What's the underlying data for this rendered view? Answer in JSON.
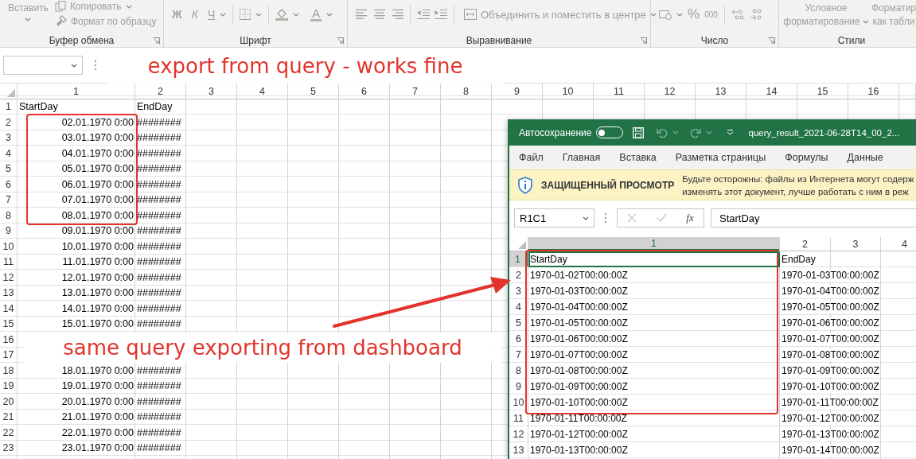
{
  "ribbon": {
    "clipboard": {
      "paste": "Вставить",
      "copy": "Копировать",
      "format_painter": "Формат по образцу",
      "label": "Буфер обмена"
    },
    "font": {
      "bold": "Ж",
      "italic": "К",
      "underline": "Ч",
      "font_color": "A",
      "label": "Шрифт"
    },
    "alignment": {
      "merge": "Объединить и поместить в центре",
      "label": "Выравнивание"
    },
    "number": {
      "percent": "%",
      "thousands": "000",
      "label": "Число"
    },
    "styles": {
      "conditional": "Условное форматирование",
      "format_table": "Форматир как табли",
      "label": "Стили"
    }
  },
  "sheet": {
    "columns": [
      "1",
      "2",
      "3",
      "4",
      "5",
      "6",
      "7",
      "8",
      "9",
      "10",
      "11",
      "12",
      "13",
      "14",
      "15",
      "16"
    ],
    "rows": [
      {
        "label": "1",
        "cells": [
          "StartDay",
          "EndDay"
        ]
      },
      {
        "label": "2",
        "cells": [
          "02.01.1970 0:00",
          "########"
        ]
      },
      {
        "label": "3",
        "cells": [
          "03.01.1970 0:00",
          "########"
        ]
      },
      {
        "label": "4",
        "cells": [
          "04.01.1970 0:00",
          "########"
        ]
      },
      {
        "label": "5",
        "cells": [
          "05.01.1970 0:00",
          "########"
        ]
      },
      {
        "label": "6",
        "cells": [
          "06.01.1970 0:00",
          "########"
        ]
      },
      {
        "label": "7",
        "cells": [
          "07.01.1970 0:00",
          "########"
        ]
      },
      {
        "label": "8",
        "cells": [
          "08.01.1970 0:00",
          "########"
        ]
      },
      {
        "label": "9",
        "cells": [
          "09.01.1970 0:00",
          "########"
        ]
      },
      {
        "label": "10",
        "cells": [
          "10.01.1970 0:00",
          "########"
        ]
      },
      {
        "label": "11",
        "cells": [
          "11.01.1970 0:00",
          "########"
        ]
      },
      {
        "label": "12",
        "cells": [
          "12.01.1970 0:00",
          "########"
        ]
      },
      {
        "label": "13",
        "cells": [
          "13.01.1970 0:00",
          "########"
        ]
      },
      {
        "label": "14",
        "cells": [
          "14.01.1970 0:00",
          "########"
        ]
      },
      {
        "label": "15",
        "cells": [
          "15.01.1970 0:00",
          "########"
        ]
      },
      {
        "label": "16"
      },
      {
        "label": "17"
      },
      {
        "label": "18",
        "cells": [
          "18.01.1970 0:00",
          "########"
        ]
      },
      {
        "label": "19",
        "cells": [
          "19.01.1970 0:00",
          "########"
        ]
      },
      {
        "label": "20",
        "cells": [
          "20.01.1970 0:00",
          "########"
        ]
      },
      {
        "label": "21",
        "cells": [
          "21.01.1970 0:00",
          "########"
        ]
      },
      {
        "label": "22",
        "cells": [
          "22.01.1970 0:00",
          "########"
        ]
      },
      {
        "label": "23",
        "cells": [
          "23.01.1970 0:00",
          "########"
        ]
      }
    ]
  },
  "window": {
    "autosave_label": "Автосохранение",
    "autosave_on": false,
    "title": "query_result_2021-06-28T14_00_2...",
    "menu": [
      "Файл",
      "Главная",
      "Вставка",
      "Разметка страницы",
      "Формулы",
      "Данные"
    ],
    "protected_view": {
      "title": "ЗАЩИЩЕННЫЙ ПРОСМОТР",
      "message_lines": [
        "Будьте осторожны: файлы из Интернета могут содерж",
        "изменять этот документ, лучше работать с ним в реж"
      ]
    },
    "name_box": "R1C1",
    "function_button": "fx",
    "formula": "StartDay",
    "sheet": {
      "columns": [
        {
          "label": "1",
          "selected": true
        },
        {
          "label": "2",
          "selected": false
        },
        {
          "label": "3",
          "selected": false
        },
        {
          "label": "4",
          "selected": false
        }
      ],
      "rows": [
        {
          "label": "1",
          "selected": true,
          "cells": [
            "StartDay",
            "EndDay"
          ]
        },
        {
          "label": "2",
          "selected": false,
          "cells": [
            "1970-01-02T00:00:00Z",
            "1970-01-03T00:00:00Z"
          ]
        },
        {
          "label": "3",
          "selected": false,
          "cells": [
            "1970-01-03T00:00:00Z",
            "1970-01-04T00:00:00Z"
          ]
        },
        {
          "label": "4",
          "selected": false,
          "cells": [
            "1970-01-04T00:00:00Z",
            "1970-01-05T00:00:00Z"
          ]
        },
        {
          "label": "5",
          "selected": false,
          "cells": [
            "1970-01-05T00:00:00Z",
            "1970-01-06T00:00:00Z"
          ]
        },
        {
          "label": "6",
          "selected": false,
          "cells": [
            "1970-01-06T00:00:00Z",
            "1970-01-07T00:00:00Z"
          ]
        },
        {
          "label": "7",
          "selected": false,
          "cells": [
            "1970-01-07T00:00:00Z",
            "1970-01-08T00:00:00Z"
          ]
        },
        {
          "label": "8",
          "selected": false,
          "cells": [
            "1970-01-08T00:00:00Z",
            "1970-01-09T00:00:00Z"
          ]
        },
        {
          "label": "9",
          "selected": false,
          "cells": [
            "1970-01-09T00:00:00Z",
            "1970-01-10T00:00:00Z"
          ]
        },
        {
          "label": "10",
          "selected": false,
          "cells": [
            "1970-01-10T00:00:00Z",
            "1970-01-11T00:00:00Z"
          ]
        },
        {
          "label": "11",
          "selected": false,
          "cells": [
            "1970-01-11T00:00:00Z",
            "1970-01-12T00:00:00Z"
          ]
        },
        {
          "label": "12",
          "selected": false,
          "cells": [
            "1970-01-12T00:00:00Z",
            "1970-01-13T00:00:00Z"
          ]
        },
        {
          "label": "13",
          "selected": false,
          "cells": [
            "1970-01-13T00:00:00Z",
            "1970-01-14T00:00:00Z"
          ]
        }
      ]
    }
  },
  "notes": [
    "export from query - works fine",
    "same query exporting from dashboard"
  ]
}
